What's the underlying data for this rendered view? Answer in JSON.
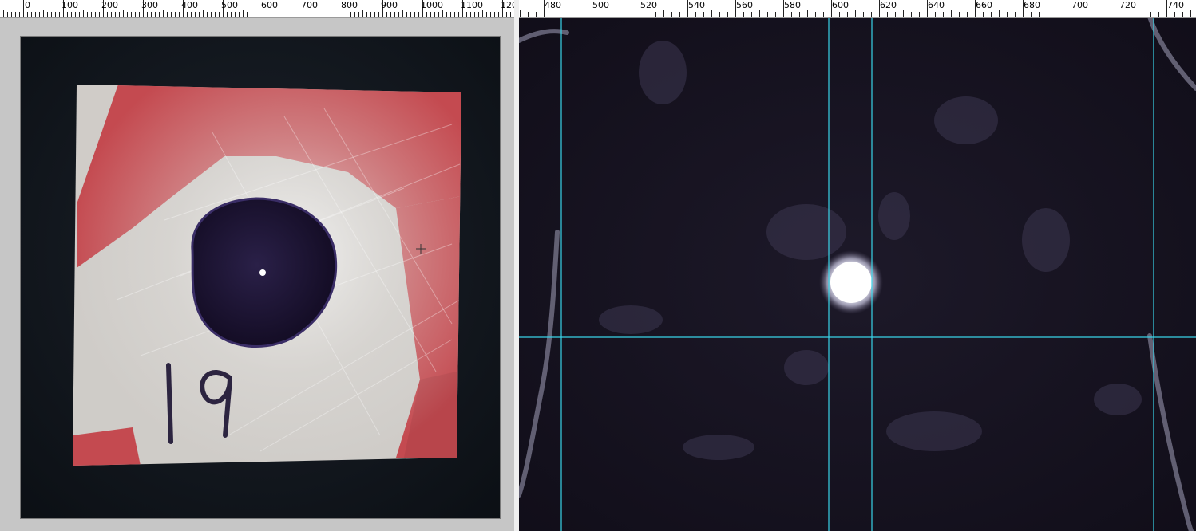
{
  "left_pane": {
    "ruler_labels": [
      "0",
      "100",
      "200",
      "300",
      "400",
      "500",
      "600",
      "700",
      "800",
      "900",
      "1000",
      "1100",
      "120"
    ],
    "sample": {
      "number_label": "19",
      "colors": {
        "background": "#131820",
        "plate": "#d5d2cd",
        "paint": "#c0474c",
        "dot": "#1c1330"
      }
    }
  },
  "right_pane": {
    "ruler_labels": [
      "480",
      "500",
      "520",
      "540",
      "560",
      "580",
      "600",
      "620",
      "640",
      "660",
      "680",
      "700",
      "720",
      "740"
    ],
    "colors": {
      "background": "#15121f",
      "guide_line": "#39d4e8",
      "highlight": "#ffffff"
    },
    "guides": {
      "vertical_count": 4,
      "horizontal_count": 1
    }
  }
}
